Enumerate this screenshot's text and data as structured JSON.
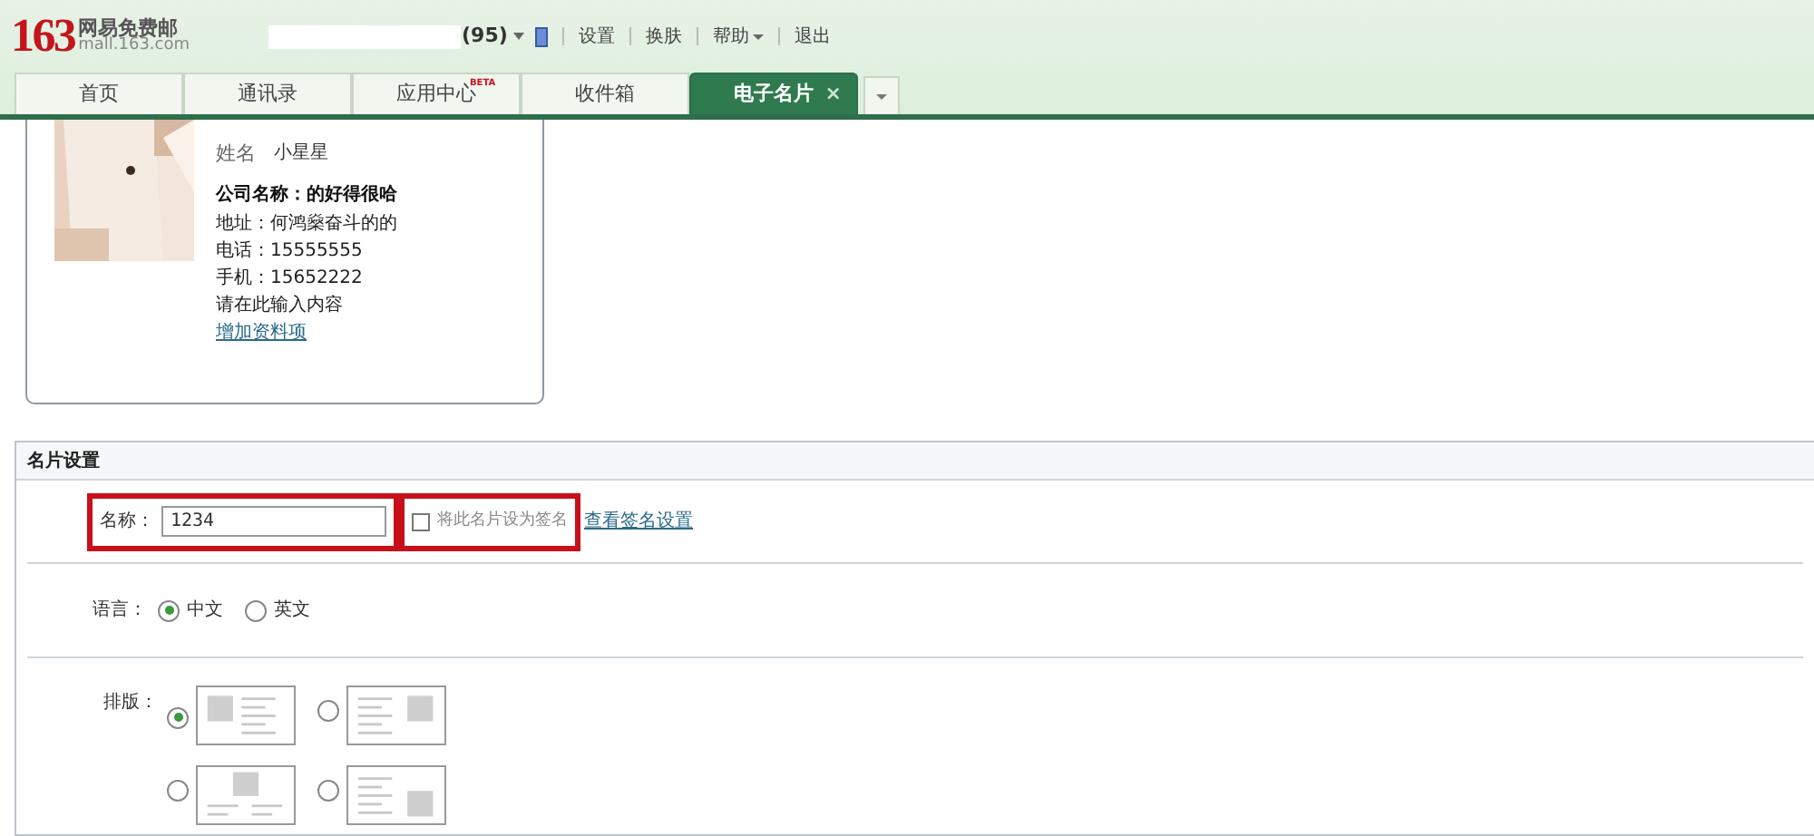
{
  "header": {
    "logo_number": "163",
    "logo_name": "网易免费邮",
    "logo_domain": "mall.163.com",
    "count": "(95)",
    "links": [
      {
        "label": "设置",
        "dropdown": false
      },
      {
        "label": "换肤",
        "dropdown": false
      },
      {
        "label": "帮助",
        "dropdown": true
      },
      {
        "label": "退出",
        "dropdown": false
      }
    ]
  },
  "tabs": [
    {
      "label": "首页",
      "selected": false
    },
    {
      "label": "通讯录",
      "selected": false
    },
    {
      "label": "应用中心",
      "badge": "BETA",
      "selected": false
    },
    {
      "label": "收件箱",
      "selected": false
    },
    {
      "label": "电子名片",
      "close": "×",
      "selected": true
    }
  ],
  "card": {
    "name_label": "姓名",
    "name_value": "小星星",
    "lines": [
      {
        "text": "公司名称：的好得很哈",
        "bold": true
      },
      {
        "text": "地址：何鸿燊奋斗的的",
        "bold": false
      },
      {
        "text": "电话：15555555",
        "bold": false
      },
      {
        "text": "手机：15652222",
        "bold": false
      },
      {
        "text": "请在此输入内容",
        "bold": false
      }
    ],
    "add_link": "增加资料项"
  },
  "settings": {
    "title": "名片设置",
    "name_label": "名称：",
    "name_value": "1234",
    "name_highlighted": true,
    "signature_checkbox": {
      "label": "将此名片设为签名",
      "checked": false,
      "highlighted": true
    },
    "signature_link": "查看签名设置",
    "language": {
      "label": "语言：",
      "options": [
        {
          "label": "中文",
          "selected": true
        },
        {
          "label": "英文",
          "selected": false
        }
      ]
    },
    "layout": {
      "label": "排版：",
      "options": [
        {
          "kind": "image-left",
          "selected": true
        },
        {
          "kind": "image-right",
          "selected": false
        },
        {
          "kind": "image-top",
          "selected": false
        },
        {
          "kind": "image-bottom-right",
          "selected": false
        }
      ]
    }
  }
}
